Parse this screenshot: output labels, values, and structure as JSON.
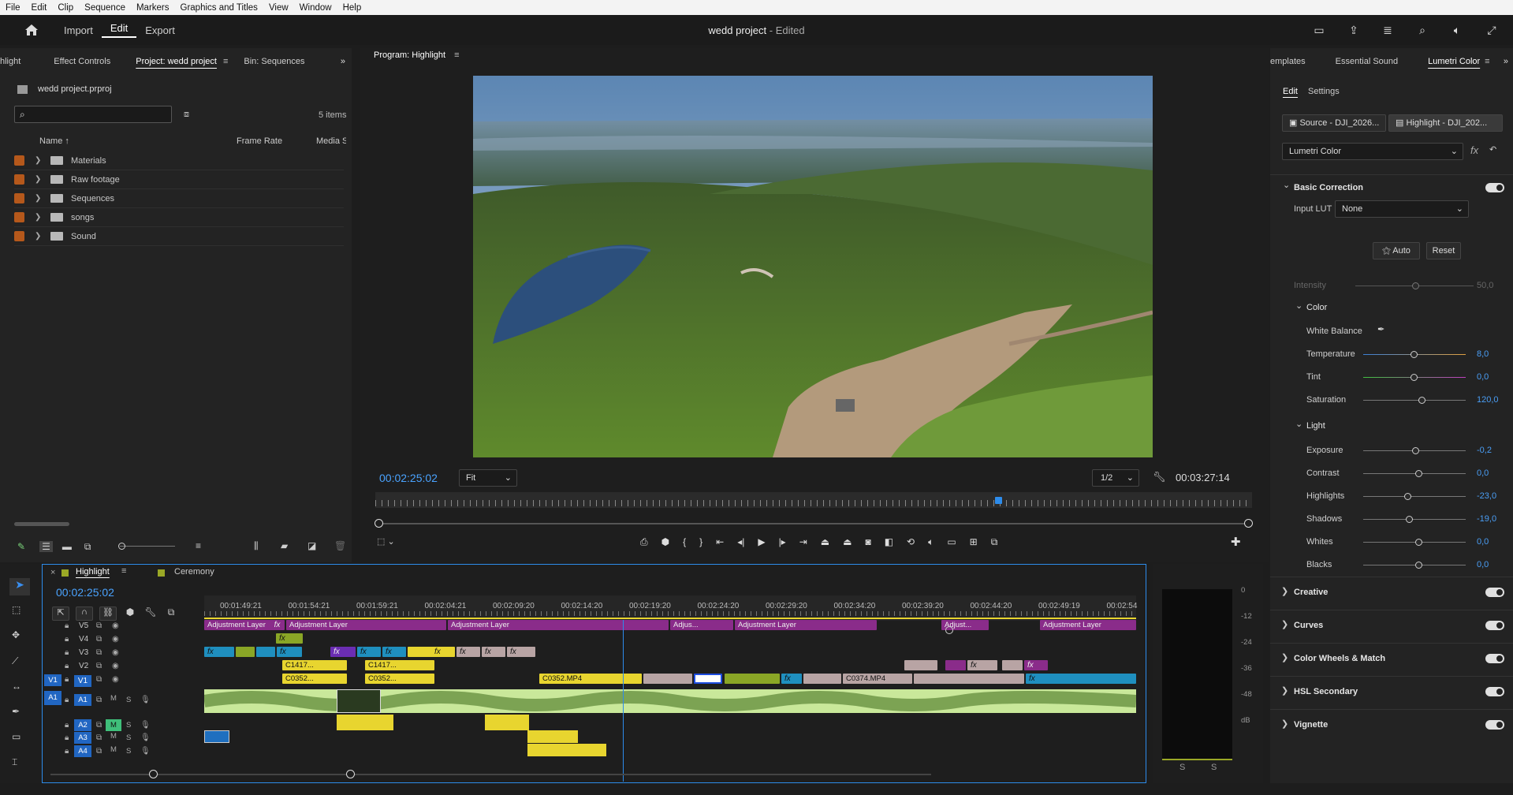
{
  "menu": [
    "File",
    "Edit",
    "Clip",
    "Sequence",
    "Markers",
    "Graphics and Titles",
    "View",
    "Window",
    "Help"
  ],
  "header": {
    "tabs": [
      "Import",
      "Edit",
      "Export"
    ],
    "active_tab": "Edit",
    "title": "wedd project",
    "edited": "- Edited"
  },
  "left_panel": {
    "tabs": [
      "hlight",
      "Effect Controls",
      "Project: wedd project",
      "Bin: Sequences"
    ],
    "active_tab": "Project: wedd project",
    "file": "wedd project.prproj",
    "search_placeholder": "",
    "count": "5 items",
    "columns": [
      "Name",
      "Frame Rate",
      "Media S"
    ],
    "items": [
      "Materials",
      "Raw footage",
      "Sequences",
      "songs",
      "Sound"
    ]
  },
  "program": {
    "title": "Program: Highlight",
    "timecode": "00:02:25:02",
    "fit": "Fit",
    "resolution": "1/2",
    "duration": "00:03:27:14",
    "playhead_fraction": 0.71
  },
  "timeline": {
    "sequence_tabs": [
      "Highlight",
      "Ceremony"
    ],
    "active": "Highlight",
    "timecode": "00:02:25:02",
    "ruler": [
      "00:01:49:21",
      "00:01:54:21",
      "00:01:59:21",
      "00:02:04:21",
      "00:02:09:20",
      "00:02:14:20",
      "00:02:19:20",
      "00:02:24:20",
      "00:02:29:20",
      "00:02:34:20",
      "00:02:39:20",
      "00:02:44:20",
      "00:02:49:19",
      "00:02:54"
    ],
    "video_tracks": [
      "V5",
      "V4",
      "V3",
      "V2",
      "V1"
    ],
    "audio_tracks": [
      "A1",
      "A2",
      "A3",
      "A4"
    ],
    "clips": {
      "adj": "Adjustment Layer",
      "adj_short": "Adjus...",
      "adj_short2": "Adjust...",
      "c1417": "C1417...",
      "c0352": "C0352...",
      "c0352mp4": "C0352.MP4",
      "c0374": "C0374.MP4",
      "fx": "fx"
    },
    "meter_scale": [
      "0",
      "-12",
      "-24",
      "-36",
      "-48",
      "dB"
    ],
    "meter_solo": [
      "S",
      "S"
    ]
  },
  "right_panel": {
    "tabs": [
      "emplates",
      "Essential Sound",
      "Lumetri Color"
    ],
    "active_tab": "Lumetri Color",
    "subtabs": [
      "Edit",
      "Settings"
    ],
    "source": "Source - DJI_2026...",
    "target": "Highlight - DJI_202...",
    "effect": "Lumetri Color",
    "basic": "Basic Correction",
    "input_lut_label": "Input LUT",
    "input_lut": "None",
    "auto": "Auto",
    "reset": "Reset",
    "intensity_label": "Intensity",
    "intensity": "50,0",
    "color": "Color",
    "white_balance": "White Balance",
    "sliders": [
      {
        "label": "Temperature",
        "value": "8,0"
      },
      {
        "label": "Tint",
        "value": "0,0"
      },
      {
        "label": "Saturation",
        "value": "120,0"
      }
    ],
    "light": "Light",
    "light_sliders": [
      {
        "label": "Exposure",
        "value": "-0,2"
      },
      {
        "label": "Contrast",
        "value": "0,0"
      },
      {
        "label": "Highlights",
        "value": "-23,0"
      },
      {
        "label": "Shadows",
        "value": "-19,0"
      },
      {
        "label": "Whites",
        "value": "0,0"
      },
      {
        "label": "Blacks",
        "value": "0,0"
      }
    ],
    "sections": [
      "Creative",
      "Curves",
      "Color Wheels & Match",
      "HSL Secondary",
      "Vignette"
    ]
  },
  "colors": {
    "accent": "#2d8ceb",
    "adjustment": "#8a2c8a",
    "video_yellow": "#e8d52f",
    "audio_green": "#c9e89a",
    "video_teal": "#1f8fbf",
    "video_pink": "#b8a4a4"
  }
}
